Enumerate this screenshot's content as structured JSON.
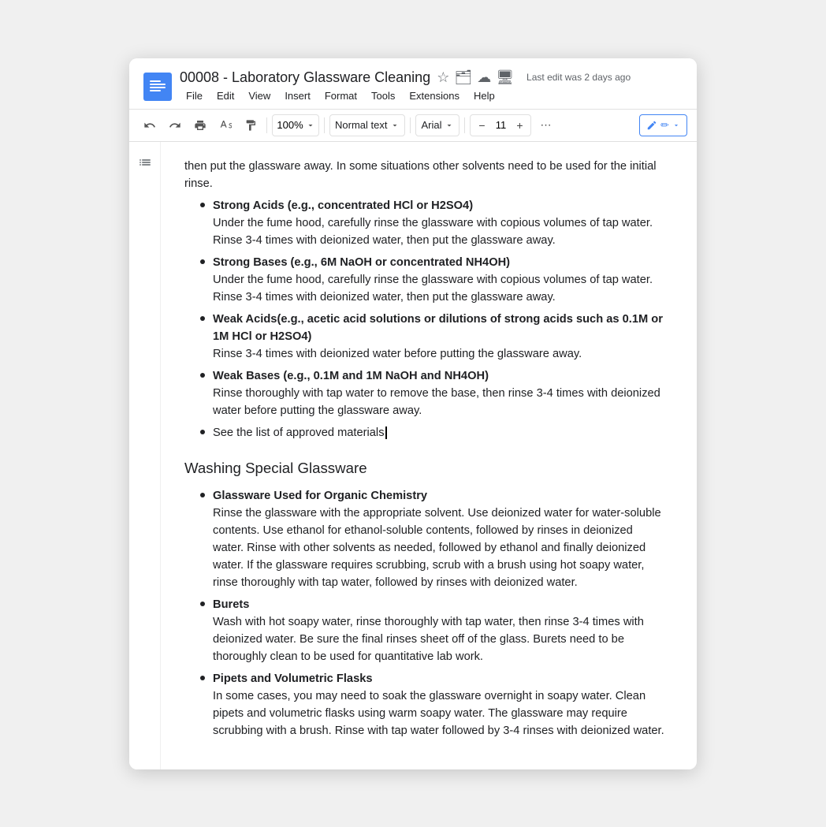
{
  "window": {
    "title": "00008 - Laboratory Glassware Cleaning",
    "last_edit": "Last edit was 2 days ago"
  },
  "menu": {
    "items": [
      "File",
      "Edit",
      "View",
      "Insert",
      "Format",
      "Tools",
      "Extensions",
      "Help"
    ]
  },
  "toolbar": {
    "zoom": "100%",
    "style": "Normal text",
    "font": "Arial",
    "font_size": "11",
    "undo_label": "↩",
    "redo_label": "↪",
    "print_label": "🖨",
    "paint_label": "A",
    "more_label": "⋯",
    "edit_label": "✏"
  },
  "content": {
    "intro_text": "then put the glassware away. In some situations other solvents need to be used for the initial rinse.",
    "bullets_part1": [
      {
        "title": "Strong Acids (e.g., concentrated HCl or H2SO4)",
        "body": "Under the fume hood, carefully rinse the glassware with copious volumes of tap water. Rinse 3-4 times with deionized water, then put the glassware away."
      },
      {
        "title": "Strong Bases (e.g., 6M NaOH or concentrated NH4OH)",
        "body": "Under the fume hood, carefully rinse the glassware with copious volumes of tap water. Rinse 3-4 times with deionized water, then put the glassware away."
      },
      {
        "title": "Weak Acids(e.g., acetic acid solutions or dilutions of strong acids such as 0.1M or 1M HCl or H2SO4)",
        "body": "Rinse 3-4 times with deionized water before putting the glassware away."
      },
      {
        "title": "Weak Bases (e.g., 0.1M and 1M NaOH and NH4OH)",
        "body": "Rinse thoroughly with tap water to remove the base, then rinse 3-4 times with deionized water before putting the glassware away."
      },
      {
        "title": "See the list of approved materials",
        "body": "",
        "cursor": true
      }
    ],
    "section2_title": "Washing Special Glassware",
    "bullets_part2": [
      {
        "title": "Glassware Used for Organic Chemistry",
        "body": "Rinse the glassware with the appropriate solvent. Use deionized water for water-soluble contents. Use ethanol for ethanol-soluble contents, followed by rinses in deionized water. Rinse with other solvents as needed, followed by ethanol and finally deionized water. If the glassware requires scrubbing, scrub with a brush using hot soapy water, rinse thoroughly with tap water, followed by rinses with deionized water."
      },
      {
        "title": "Burets",
        "body": "Wash with hot soapy water, rinse thoroughly with tap water, then rinse 3-4 times with deionized water. Be sure the final rinses sheet off of the glass. Burets need to be thoroughly clean to be used for quantitative lab work."
      },
      {
        "title": "Pipets and Volumetric Flasks",
        "body": "In some cases, you may need to soak the glassware overnight in soapy water. Clean pipets and volumetric flasks using warm soapy water. The glassware may require scrubbing with a brush. Rinse with tap water followed by 3-4 rinses with deionized water."
      }
    ]
  }
}
